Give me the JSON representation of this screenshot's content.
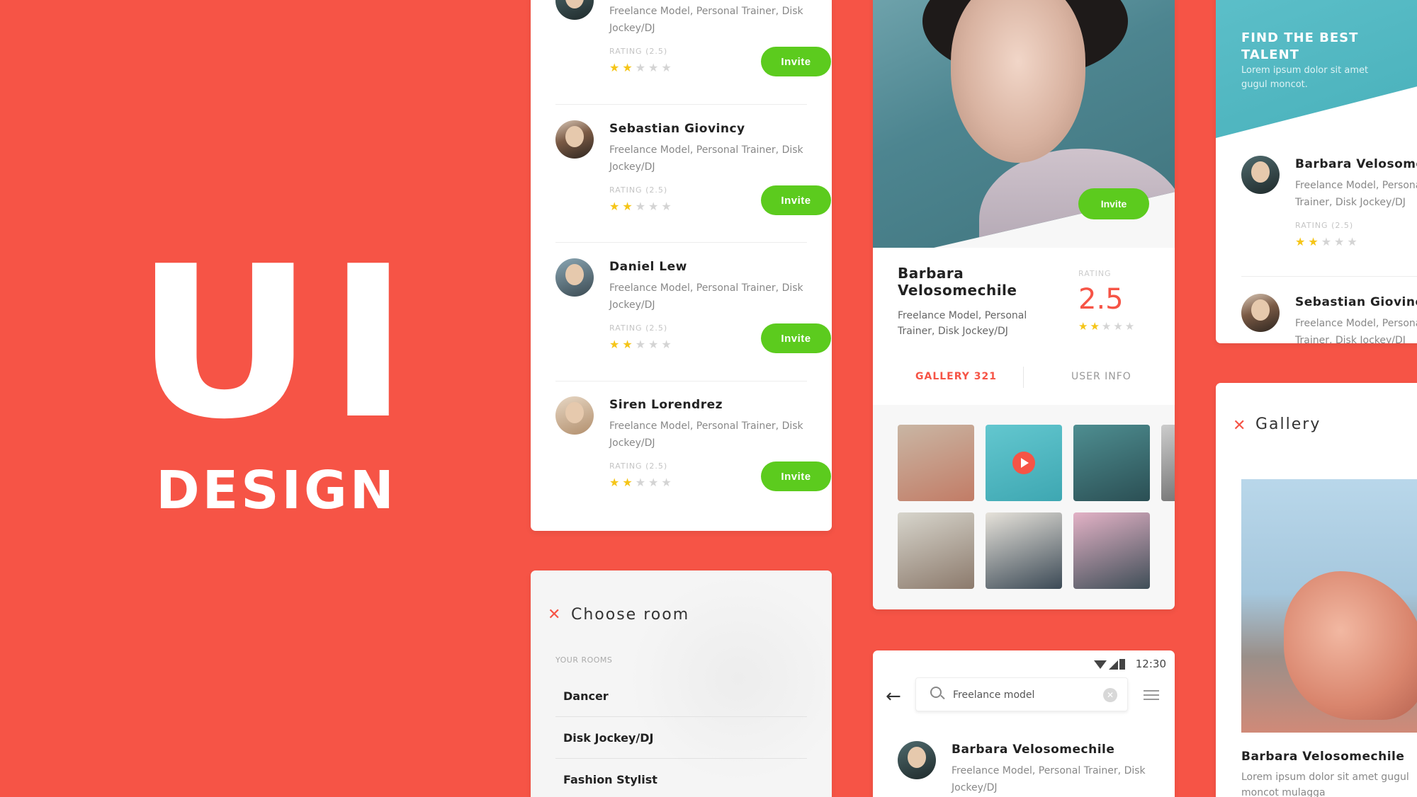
{
  "hero": {
    "title": "UI",
    "subtitle": "DESIGN"
  },
  "people_list": {
    "rating_label": "RATING (2.5)",
    "invite_label": "Invite",
    "stars": "★★",
    "stars_off": "★★★",
    "description": "Freelance Model,  Personal Trainer, Disk Jockey/DJ",
    "people": [
      {
        "name": ""
      },
      {
        "name": "Sebastian Giovincy"
      },
      {
        "name": "Daniel Lew"
      },
      {
        "name": "Siren Lorendrez"
      }
    ]
  },
  "room": {
    "title": "Choose room",
    "section_label": "YOUR ROOMS",
    "items": [
      "Dancer",
      "Disk Jockey/DJ",
      "Fashion Stylist"
    ]
  },
  "profile": {
    "invite_label": "Invite",
    "name": "Barbara Velosomechile",
    "description": "Freelance Model,  Personal Trainer, Disk Jockey/DJ",
    "rating_label": "RATING",
    "rating": "2.5",
    "tab_gallery": "GALLERY 321",
    "tab_info": "USER INFO"
  },
  "search": {
    "time": "12:30",
    "query": "Freelance model",
    "result_name": "Barbara Velosomechile",
    "result_desc": "Freelance Model,  Personal Trainer, Disk Jockey/DJ"
  },
  "talent": {
    "title": "FIND THE BEST TALENT",
    "subtitle": "Lorem ipsum dolor sit amet gugul moncot.",
    "rating_label": "RATING (2.5)",
    "people": [
      {
        "name": "Barbara Velosomechile",
        "desc": "Freelance Model,  Personal Trainer, Disk Jockey/DJ"
      },
      {
        "name": "Sebastian Giovincy",
        "desc": "Freelance Model,  Personal Trainer, Disk Jockey/DJ"
      }
    ]
  },
  "gallery": {
    "title": "Gallery",
    "name": "Barbara Velosomechile",
    "desc": "Lorem ipsum dolor sit amet gugul moncot mulagga"
  },
  "colors": {
    "background": "#F65446",
    "accent_green": "#5CCB1E",
    "accent_red": "#F65446",
    "teal": "#4FB3BD",
    "star": "#F5C518"
  }
}
